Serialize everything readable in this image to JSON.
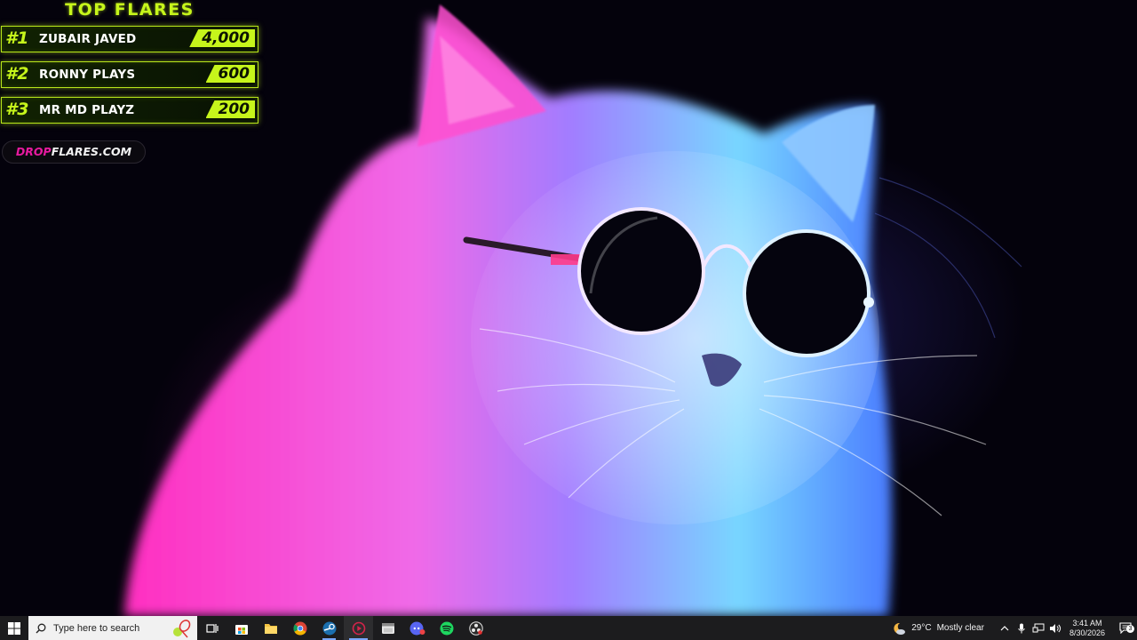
{
  "overlay": {
    "title": "TOP FLARES",
    "rows": [
      {
        "rank": "#1",
        "name": "ZUBAIR JAVED",
        "amount": "4,000"
      },
      {
        "rank": "#2",
        "name": "RONNY PLAYS",
        "amount": "600"
      },
      {
        "rank": "#3",
        "name": "MR MD PLAYZ",
        "amount": "200"
      }
    ],
    "site_drop": "DROP",
    "site_rest": "FLARES.COM",
    "accent": "#c6f51b",
    "brand_pink": "#e81aa0"
  },
  "wallpaper": {
    "subject": "neon-cat-with-round-sunglasses",
    "colors": [
      "#ff3fc8",
      "#9b6bff",
      "#6fd8ff"
    ]
  },
  "taskbar": {
    "search_placeholder": "Type here to search",
    "apps": [
      {
        "icon": "task-view-icon",
        "state": "normal"
      },
      {
        "icon": "microsoft-store-icon",
        "state": "normal"
      },
      {
        "icon": "file-explorer-icon",
        "state": "normal"
      },
      {
        "icon": "chrome-icon",
        "state": "normal"
      },
      {
        "icon": "steam-icon",
        "state": "running"
      },
      {
        "icon": "media-player-icon",
        "state": "active"
      },
      {
        "icon": "window-app-icon",
        "state": "normal"
      },
      {
        "icon": "discord-icon",
        "state": "normal"
      },
      {
        "icon": "spotify-icon",
        "state": "normal"
      },
      {
        "icon": "obs-icon",
        "state": "normal"
      }
    ],
    "weather_temp": "29°C",
    "weather_desc": "Mostly clear",
    "time": "3:41 AM",
    "date": "8/30/2026",
    "notification_count": "3"
  }
}
